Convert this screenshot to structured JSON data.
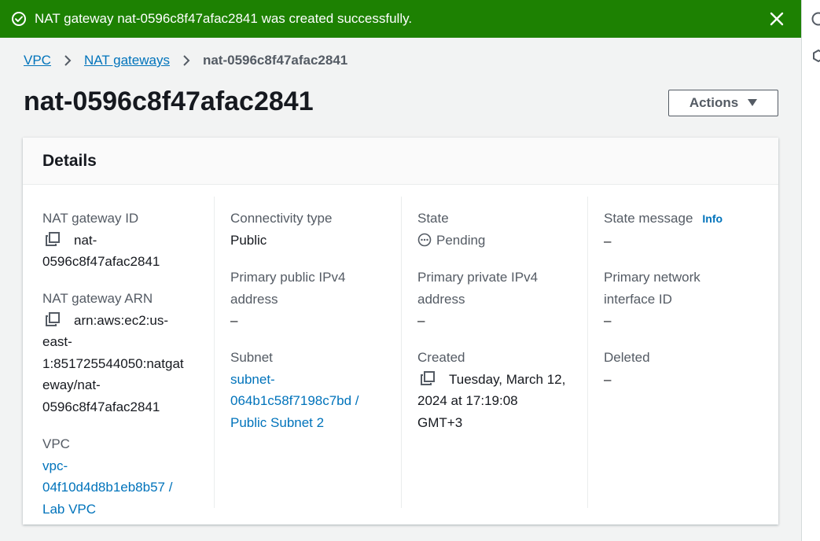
{
  "flash": {
    "message": "NAT gateway nat-0596c8f47afac2841 was created successfully.",
    "color": "#1d8102"
  },
  "breadcrumb": {
    "item1": "VPC",
    "item2": "NAT gateways",
    "current": "nat-0596c8f47afac2841"
  },
  "page": {
    "title": "nat-0596c8f47afac2841",
    "actions_label": "Actions"
  },
  "details": {
    "heading": "Details",
    "nat_gateway_id": {
      "label": "NAT gateway ID",
      "value_l1": "nat-",
      "value_l2": "0596c8f47afac2841"
    },
    "nat_gateway_arn": {
      "label": "NAT gateway ARN",
      "value_l1": "arn:aws:ec2:us-",
      "value_l2": "east-",
      "value_l3": "1:851725544050:natgat",
      "value_l4": "eway/nat-",
      "value_l5": "0596c8f47afac2841"
    },
    "vpc": {
      "label": "VPC",
      "value_l1": "vpc-",
      "value_l2": "04f10d4d8b1eb8b57 /",
      "value_l3": "Lab VPC"
    },
    "connectivity_type": {
      "label": "Connectivity type",
      "value": "Public"
    },
    "primary_public_ipv4": {
      "label_l1": "Primary public IPv4",
      "label_l2": "address",
      "value": "–"
    },
    "subnet": {
      "label": "Subnet",
      "value_l1": "subnet-",
      "value_l2": "064b1c58f7198c7bd /",
      "value_l3": "Public Subnet 2"
    },
    "state": {
      "label": "State",
      "value": "Pending"
    },
    "primary_private_ipv4": {
      "label_l1": "Primary private IPv4",
      "label_l2": "address",
      "value": "–"
    },
    "created": {
      "label": "Created",
      "value_l1": "Tuesday, March 12,",
      "value_l2": "2024 at 17:19:08",
      "value_l3": "GMT+3"
    },
    "state_message": {
      "label": "State message",
      "info": "Info",
      "value": "–"
    },
    "primary_network_interface": {
      "label_l1": "Primary network",
      "label_l2": "interface ID",
      "value": "–"
    },
    "deleted": {
      "label": "Deleted",
      "value": "–"
    }
  },
  "icons": {
    "flash_status": "check-circle-icon",
    "flash_close": "close-icon",
    "copy": "copy-icon",
    "pending": "pending-icon",
    "right_panel_1": "info-icon",
    "right_panel_2": "settings-icon"
  },
  "colors": {
    "link": "#0073bb",
    "success": "#1d8102",
    "label": "#545b64"
  }
}
